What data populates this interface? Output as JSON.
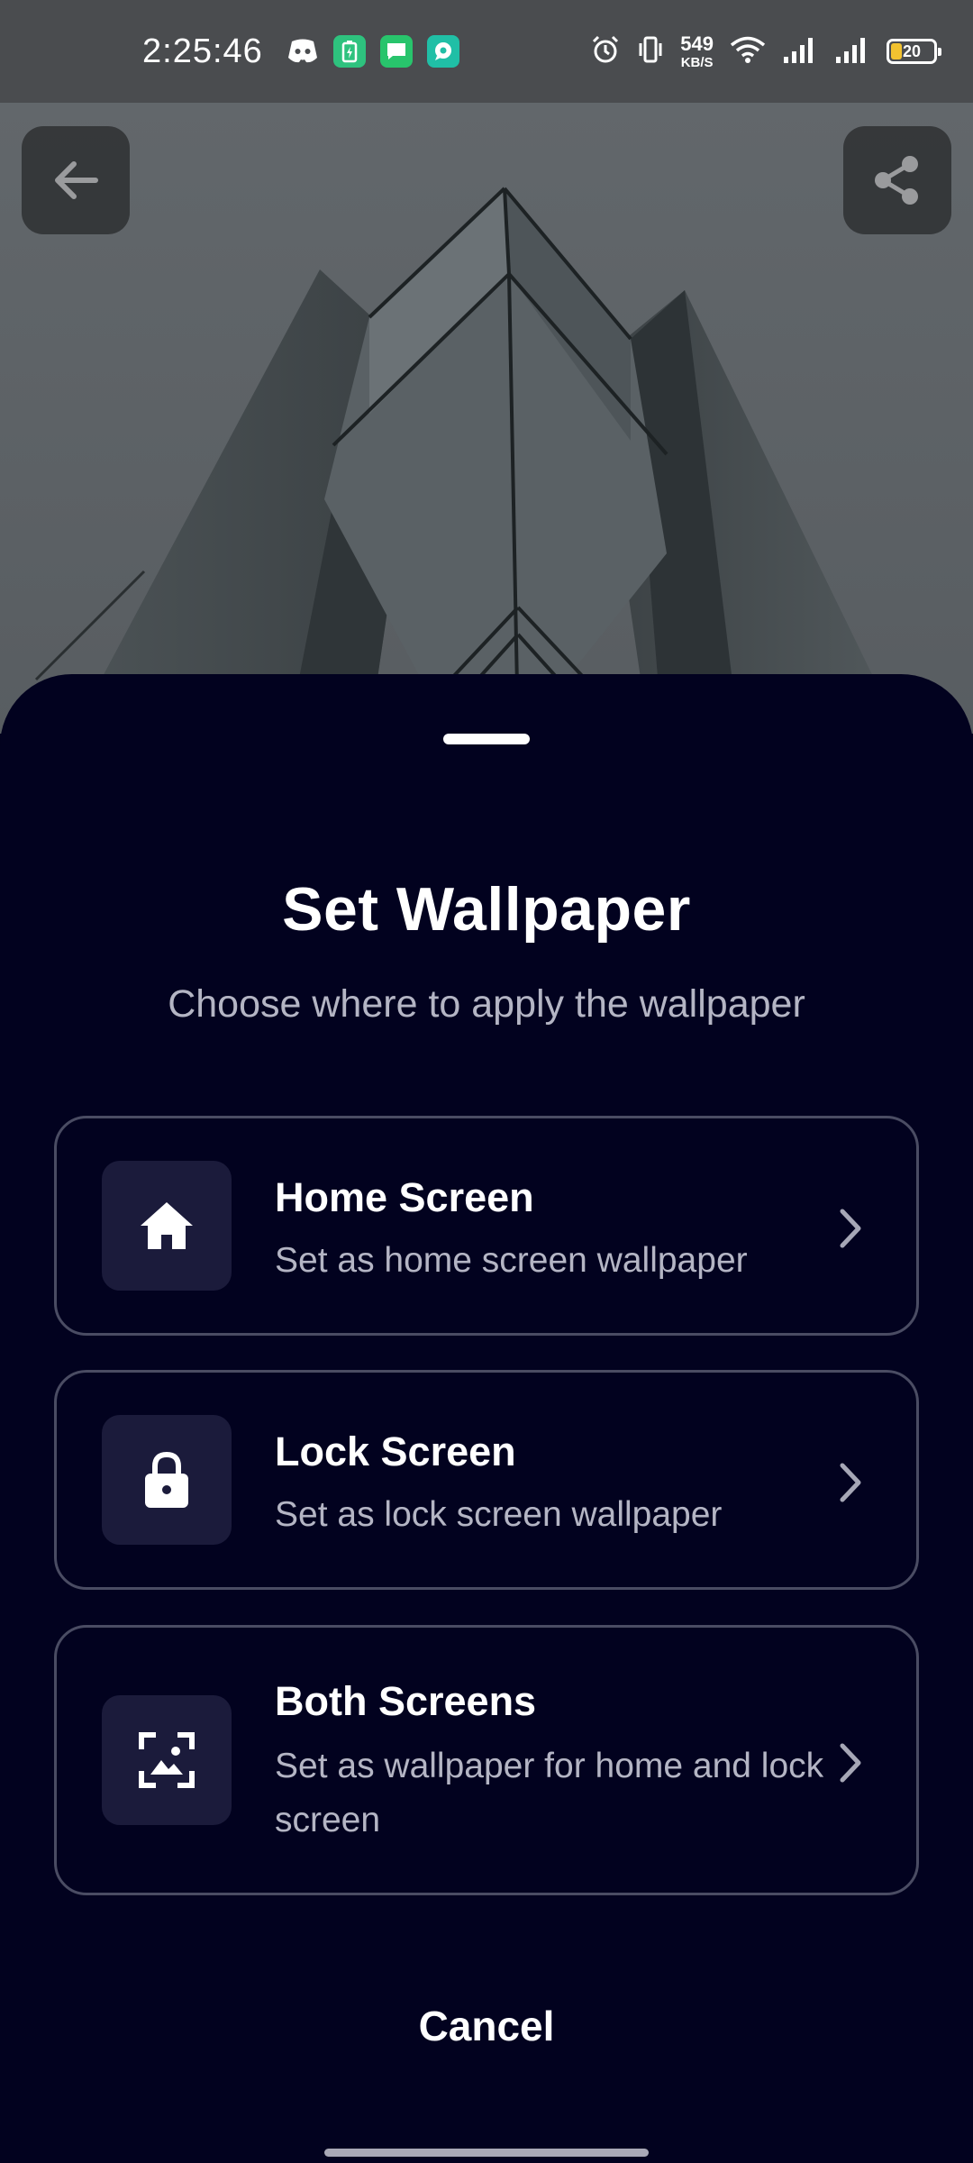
{
  "status_bar": {
    "time": "2:25:46",
    "net_speed_value": "549",
    "net_speed_unit": "KB/S",
    "battery_level": "20",
    "notification_icons": [
      "discord-icon",
      "battery-saver-app-icon",
      "messages-app-icon",
      "chat-app-icon"
    ],
    "system_icons": [
      "alarm-icon",
      "vibrate-icon",
      "wifi-icon",
      "signal-icon",
      "signal-icon"
    ]
  },
  "preview": {
    "back_icon": "arrow-left-icon",
    "share_icon": "share-icon"
  },
  "sheet": {
    "title": "Set Wallpaper",
    "subtitle": "Choose where to apply the wallpaper",
    "options": [
      {
        "icon": "home-icon",
        "title": "Home Screen",
        "description": "Set as home screen wallpaper"
      },
      {
        "icon": "lock-icon",
        "title": "Lock Screen",
        "description": "Set as lock screen wallpaper"
      },
      {
        "icon": "wallpaper-icon",
        "title": "Both Screens",
        "description": "Set as wallpaper for home and lock screen"
      }
    ],
    "cancel_label": "Cancel"
  },
  "colors": {
    "sheet_background": "#02021f",
    "option_border": "#4a4c63",
    "icon_box": "#1b1b3b",
    "secondary_text": "#b4b5c4",
    "status_bar": "#4a4c4f",
    "battery_fill": "#f2c230"
  }
}
